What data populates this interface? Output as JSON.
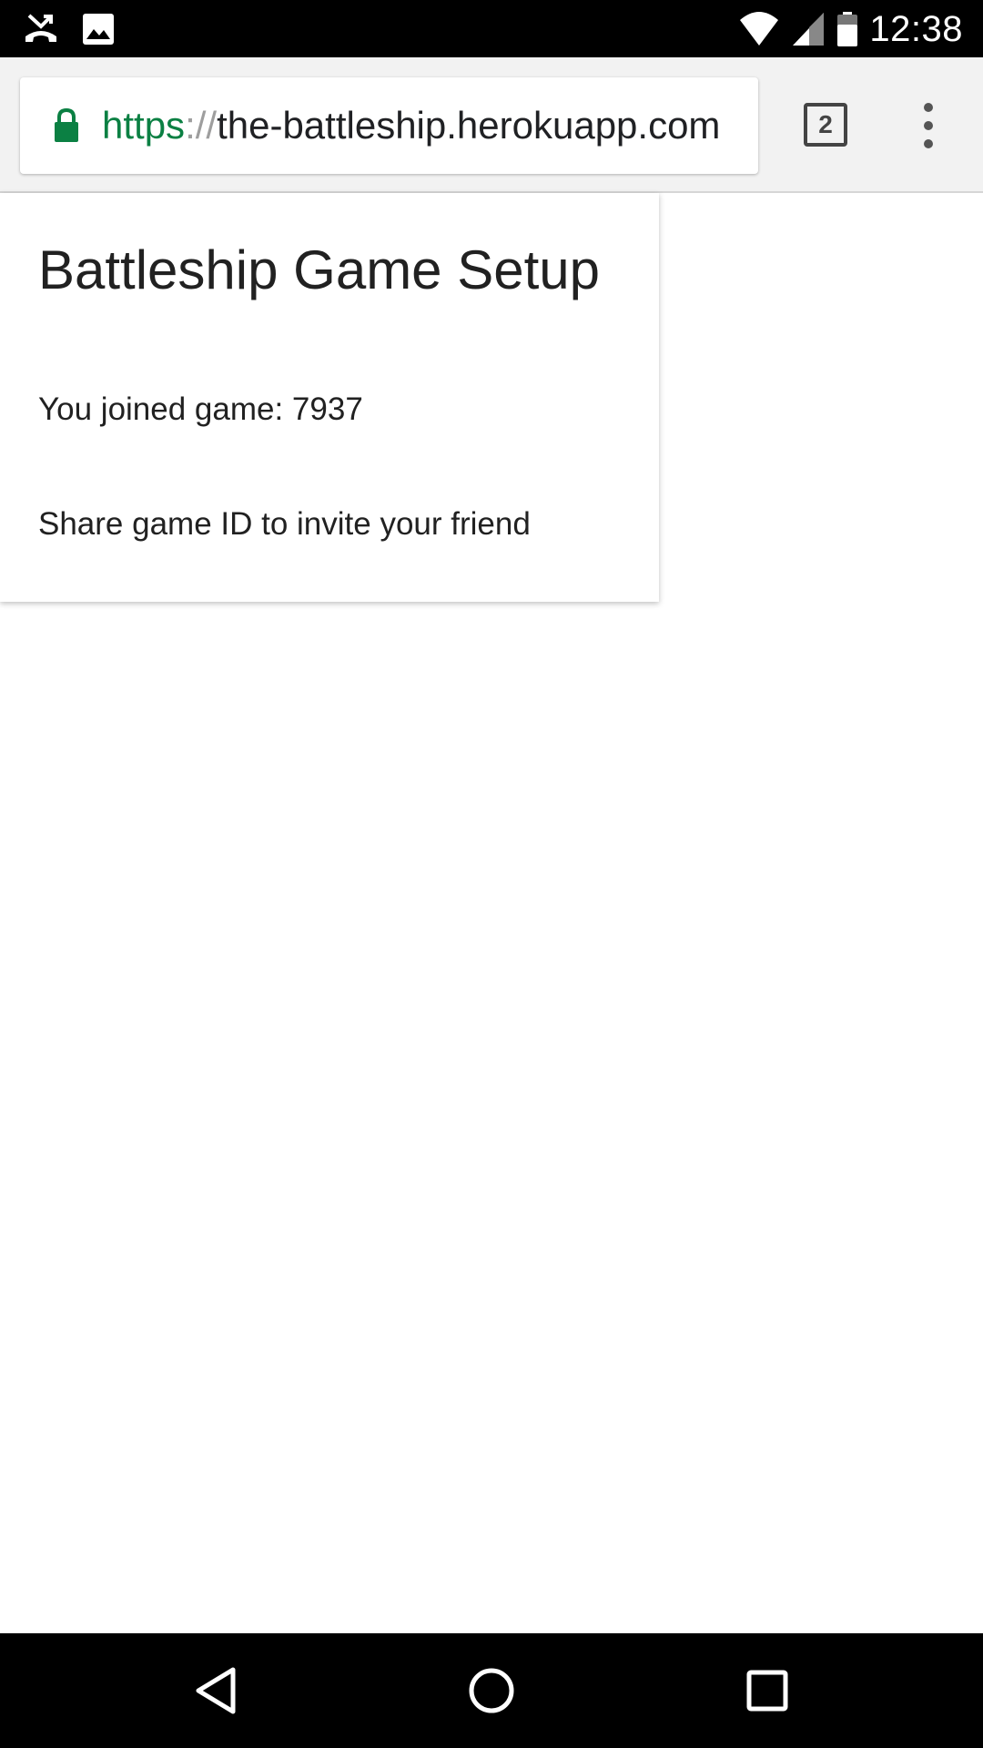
{
  "status_bar": {
    "time": "12:38",
    "left_icons": [
      "missed-call-icon",
      "image-icon"
    ],
    "right_icons": [
      "wifi-icon",
      "signal-icon",
      "battery-icon"
    ]
  },
  "browser": {
    "url_scheme": "https",
    "url_separator": "://",
    "url_host": "the-battleship.herokuapp.com",
    "tab_count": "2",
    "colors": {
      "secure": "#0b8043",
      "toolbar": "#f2f2f2"
    }
  },
  "page": {
    "title": "Battleship Game Setup",
    "joined_text": "You joined game: 7937",
    "share_text": "Share game ID to invite your friend"
  },
  "nav_bar": {
    "buttons": [
      "back-icon",
      "home-icon",
      "recents-icon"
    ]
  }
}
